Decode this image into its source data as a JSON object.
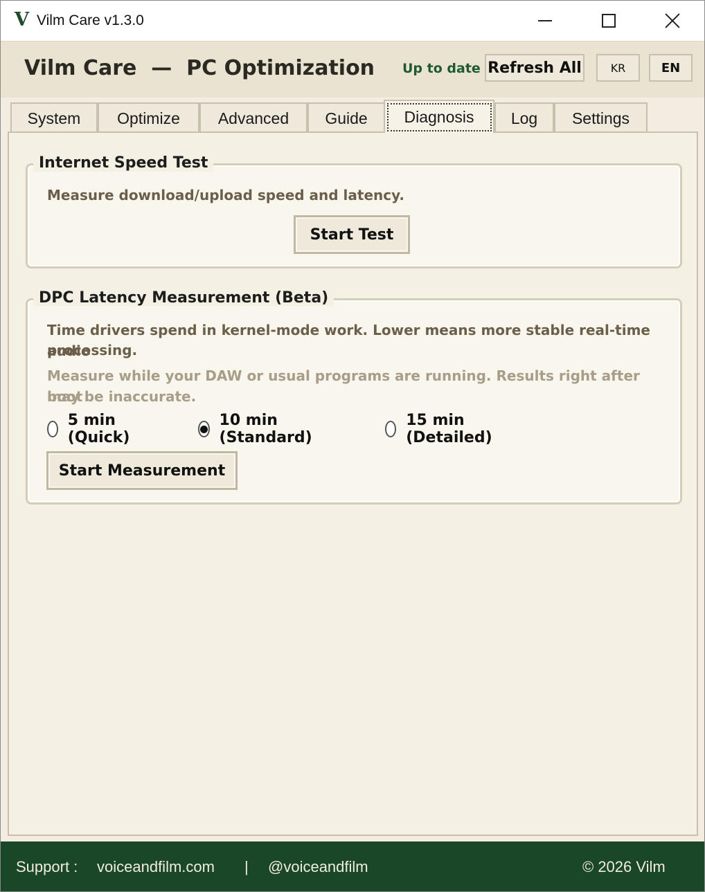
{
  "window": {
    "logo_letter": "V",
    "title": "Vilm Care v1.3.0"
  },
  "header": {
    "title": "Vilm Care  —  PC Optimization",
    "status": "Up to date",
    "refresh_label": "Refresh All",
    "lang_kr": "KR",
    "lang_en": "EN"
  },
  "tabs": [
    {
      "label": "System"
    },
    {
      "label": "Optimize"
    },
    {
      "label": "Advanced"
    },
    {
      "label": "Guide"
    },
    {
      "label": "Diagnosis",
      "active": true
    },
    {
      "label": "Log"
    },
    {
      "label": "Settings"
    }
  ],
  "speed_test": {
    "title": "Internet Speed Test",
    "description": "Measure download/upload speed and latency.",
    "button": "Start Test"
  },
  "dpc": {
    "title": "DPC Latency Measurement (Beta)",
    "description_line1": "Time drivers spend in kernel-mode work. Lower means more stable real-time audio",
    "description_line2": "processing.",
    "hint_line1": "Measure while your DAW or usual programs are running. Results right after boot",
    "hint_line2": "may be inaccurate.",
    "options": [
      {
        "label": "5 min (Quick)",
        "checked": false
      },
      {
        "label": "10 min (Standard)",
        "checked": true
      },
      {
        "label": "15 min (Detailed)",
        "checked": false
      }
    ],
    "button": "Start Measurement"
  },
  "footer": {
    "support_label": "Support :",
    "site": "voiceandfilm.com",
    "separator": "|",
    "handle": "@voiceandfilm",
    "copyright": "© 2026 Vilm"
  },
  "colors": {
    "accent_green": "#1a4727",
    "status_green": "#1e5a2e",
    "panel_bg": "#f4f0e4",
    "header_bg": "#ebe3d2"
  }
}
